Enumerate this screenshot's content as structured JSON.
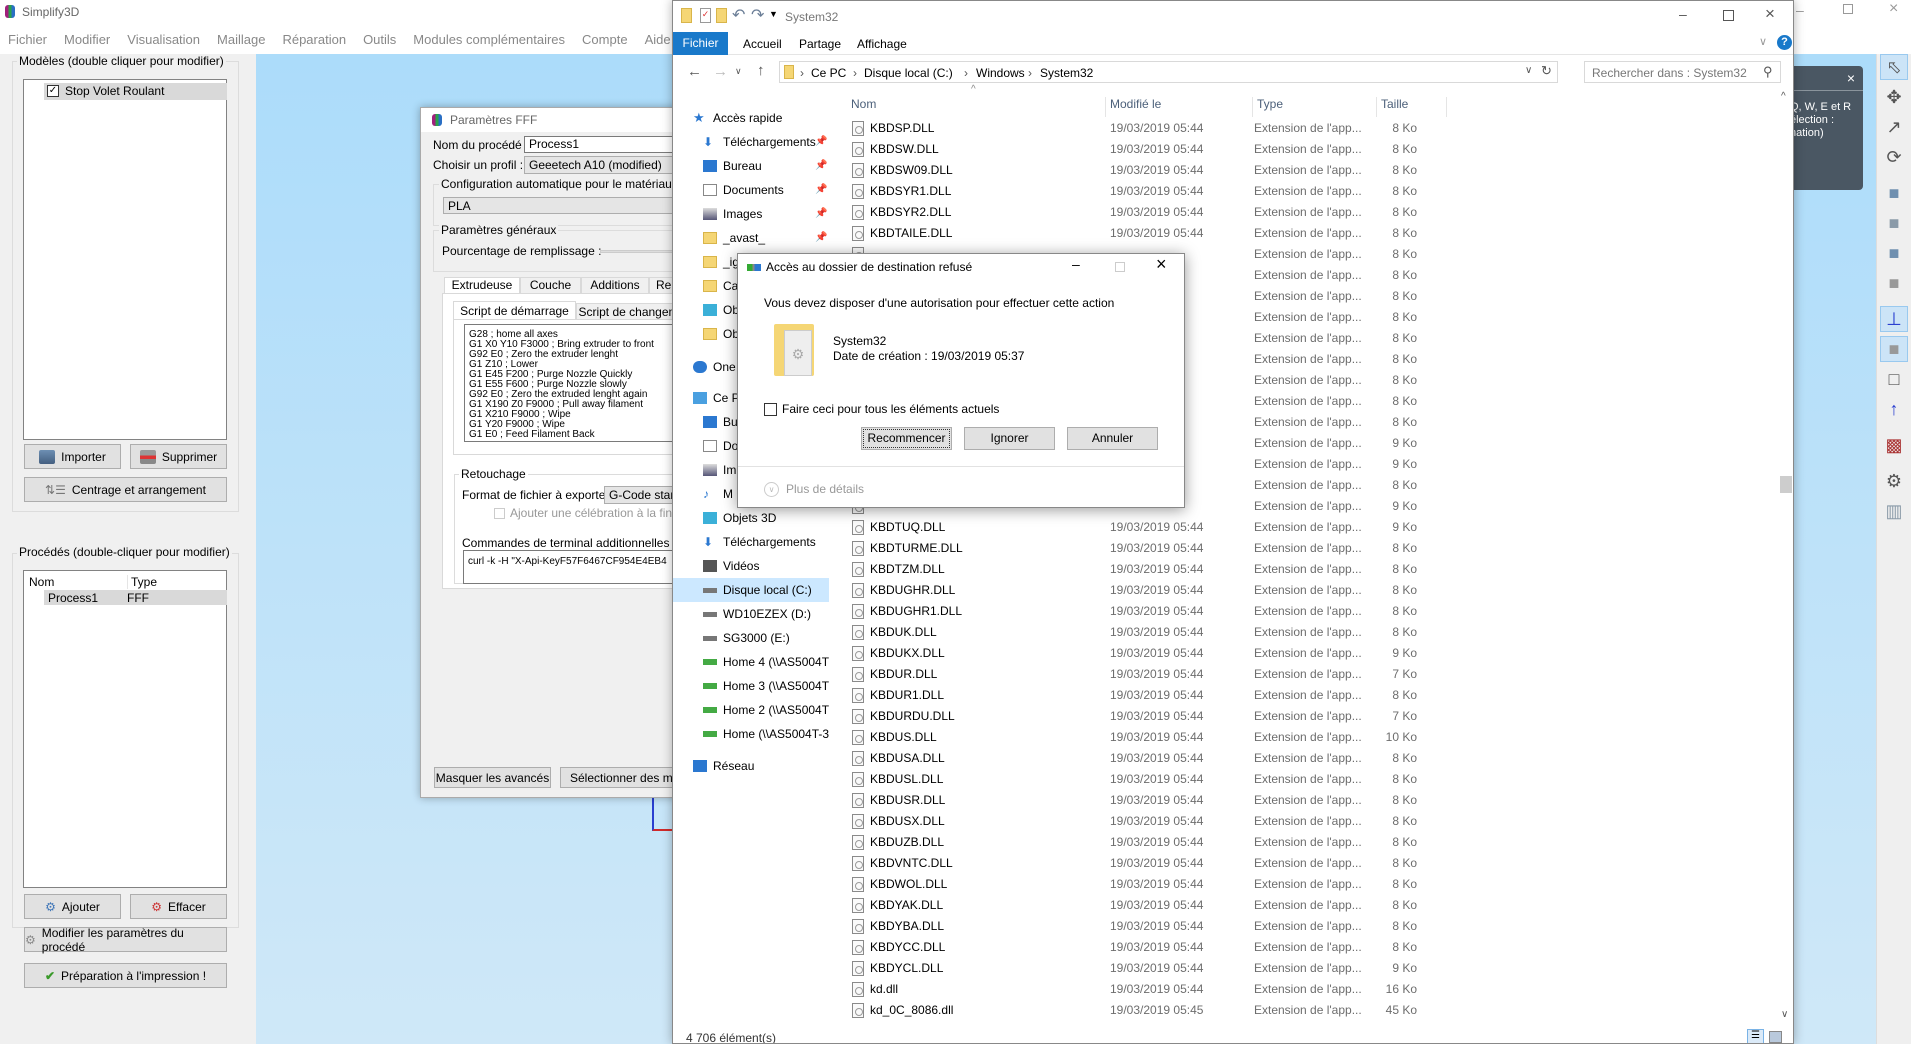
{
  "app": {
    "title": "Simplify3D",
    "menu": [
      "Fichier",
      "Modifier",
      "Visualisation",
      "Maillage",
      "Réparation",
      "Outils",
      "Modules complémentaires",
      "Compte",
      "Aide"
    ],
    "models_group": "Modèles (double cliquer pour modifier)",
    "models": [
      {
        "name": "Stop Volet Roulant",
        "checked": true
      }
    ],
    "import_btn": "Importer",
    "delete_btn": "Supprimer",
    "center_btn": "Centrage et arrangement",
    "processes_group": "Procédés (double-cliquer pour modifier)",
    "processes_headers": [
      "Nom",
      "Type"
    ],
    "processes": [
      {
        "name": "Process1",
        "type": "FFF"
      }
    ],
    "add_btn": "Ajouter",
    "erase_btn": "Effacer",
    "edit_process_btn": "Modifier les paramètres du procédé",
    "prepare_btn": "Préparation à l'impression !",
    "tooltip_lines": [
      "Q, W, E et R",
      "élection :",
      "nation)"
    ],
    "tooltip_close": "×"
  },
  "fff": {
    "title": "Paramètres FFF",
    "process_name_label": "Nom du procédé :",
    "process_name": "Process1",
    "profile_label": "Choisir un profil :",
    "profile": "Geeetech A10 (modified)",
    "material_group": "Configuration automatique pour le matériau",
    "material": "PLA",
    "general_group": "Paramètres généraux",
    "infill_label": "Pourcentage de remplissage :",
    "tabs": [
      "Extrudeuse",
      "Couche",
      "Additions",
      "Re"
    ],
    "subtabs": [
      "Script de démarrage",
      "Script de changem"
    ],
    "script_lines": [
      "G28 ; home all axes",
      "G1 X0 Y10 F3000 ; Bring extruder to front",
      "G92 E0 ; Zero the extruder lenght",
      "G1 Z10 ; Lower",
      "G1 E45 F200 ; Purge Nozzle Quickly",
      "G1 E55 F600 ; Purge Nozzle slowly",
      "G92 E0 ; Zero the extruded lenght again",
      "G1 X190 Z0 F9000 ; Pull away filament",
      "G1 X210 F9000 ; Wipe",
      "G1 Y20 F9000 ; Wipe",
      "G1 E0 ; Feed Filament Back"
    ],
    "post_group": "Retouchage",
    "export_label": "Format de fichier à exporter",
    "export_value": "G-Code stanc",
    "celebration_label": "Ajouter une célébration à la fin de",
    "terminal_label": "Commandes de terminal additionnelles pour",
    "terminal_value": "curl -k -H \"X-Api-KeyF57F6467CF954E4EB4",
    "hide_adv_btn": "Masquer les avancés",
    "select_btn": "Sélectionner des mod"
  },
  "explorer": {
    "title": "System32",
    "ribbon_tabs": [
      "Fichier",
      "Accueil",
      "Partage",
      "Affichage"
    ],
    "breadcrumb": [
      "Ce PC",
      "Disque local (C:)",
      "Windows",
      "System32"
    ],
    "search_placeholder": "Rechercher dans : System32",
    "columns": [
      "Nom",
      "Modifié le",
      "Type",
      "Taille"
    ],
    "nav": [
      {
        "label": "Accès rapide",
        "icon": "star",
        "lvl": 0,
        "pin": false
      },
      {
        "label": "Téléchargements",
        "icon": "download",
        "lvl": 1,
        "pin": true
      },
      {
        "label": "Bureau",
        "icon": "desktop",
        "lvl": 1,
        "pin": true
      },
      {
        "label": "Documents",
        "icon": "document",
        "lvl": 1,
        "pin": true
      },
      {
        "label": "Images",
        "icon": "image",
        "lvl": 1,
        "pin": true
      },
      {
        "label": "_avast_",
        "icon": "folder",
        "lvl": 1,
        "pin": true
      },
      {
        "label": "_ig",
        "icon": "folder",
        "lvl": 1,
        "pin": false
      },
      {
        "label": "Ca",
        "icon": "folder",
        "lvl": 1,
        "pin": false
      },
      {
        "label": "Ob",
        "icon": "cube",
        "lvl": 1,
        "pin": false
      },
      {
        "label": "Ob",
        "icon": "folder",
        "lvl": 1,
        "pin": false
      },
      {
        "label": "One",
        "icon": "cloud",
        "lvl": 0,
        "pin": false
      },
      {
        "label": "Ce P",
        "icon": "pc",
        "lvl": 0,
        "pin": false
      },
      {
        "label": "Bu",
        "icon": "desktop",
        "lvl": 1,
        "pin": false
      },
      {
        "label": "Do",
        "icon": "document",
        "lvl": 1,
        "pin": false
      },
      {
        "label": "Im",
        "icon": "image",
        "lvl": 1,
        "pin": false
      },
      {
        "label": "M",
        "icon": "music",
        "lvl": 1,
        "pin": false
      },
      {
        "label": "Objets 3D",
        "icon": "cube",
        "lvl": 1,
        "pin": false
      },
      {
        "label": "Téléchargements",
        "icon": "download",
        "lvl": 1,
        "pin": false
      },
      {
        "label": "Vidéos",
        "icon": "video",
        "lvl": 1,
        "pin": false
      },
      {
        "label": "Disque local (C:)",
        "icon": "drive",
        "lvl": 1,
        "pin": false,
        "selected": true
      },
      {
        "label": "WD10EZEX (D:)",
        "icon": "drive",
        "lvl": 1,
        "pin": false
      },
      {
        "label": "SG3000 (E:)",
        "icon": "drive",
        "lvl": 1,
        "pin": false
      },
      {
        "label": "Home 4 (\\\\AS5004T",
        "icon": "netdrive",
        "lvl": 1,
        "pin": false
      },
      {
        "label": "Home 3 (\\\\AS5004T",
        "icon": "netdrive",
        "lvl": 1,
        "pin": false
      },
      {
        "label": "Home 2 (\\\\AS5004T",
        "icon": "netdrive",
        "lvl": 1,
        "pin": false
      },
      {
        "label": "Home (\\\\AS5004T-3",
        "icon": "netdrive",
        "lvl": 1,
        "pin": false
      },
      {
        "label": "Réseau",
        "icon": "network",
        "lvl": 0,
        "pin": false
      }
    ],
    "files": [
      {
        "name": "KBDSP.DLL",
        "date": "19/03/2019 05:44",
        "type": "Extension de l'app...",
        "size": "8 Ko"
      },
      {
        "name": "KBDSW.DLL",
        "date": "19/03/2019 05:44",
        "type": "Extension de l'app...",
        "size": "8 Ko"
      },
      {
        "name": "KBDSW09.DLL",
        "date": "19/03/2019 05:44",
        "type": "Extension de l'app...",
        "size": "8 Ko"
      },
      {
        "name": "KBDSYR1.DLL",
        "date": "19/03/2019 05:44",
        "type": "Extension de l'app...",
        "size": "8 Ko"
      },
      {
        "name": "KBDSYR2.DLL",
        "date": "19/03/2019 05:44",
        "type": "Extension de l'app...",
        "size": "8 Ko"
      },
      {
        "name": "KBDTAILE.DLL",
        "date": "19/03/2019 05:44",
        "type": "Extension de l'app...",
        "size": "8 Ko"
      },
      {
        "name": "",
        "date": "",
        "type": "Extension de l'app...",
        "size": "8 Ko"
      },
      {
        "name": "",
        "date": "",
        "type": "Extension de l'app...",
        "size": "8 Ko"
      },
      {
        "name": "",
        "date": "",
        "type": "Extension de l'app...",
        "size": "8 Ko"
      },
      {
        "name": "",
        "date": "",
        "type": "Extension de l'app...",
        "size": "8 Ko"
      },
      {
        "name": "",
        "date": "",
        "type": "Extension de l'app...",
        "size": "8 Ko"
      },
      {
        "name": "",
        "date": "",
        "type": "Extension de l'app...",
        "size": "8 Ko"
      },
      {
        "name": "",
        "date": "",
        "type": "Extension de l'app...",
        "size": "8 Ko"
      },
      {
        "name": "",
        "date": "",
        "type": "Extension de l'app...",
        "size": "8 Ko"
      },
      {
        "name": "",
        "date": "",
        "type": "Extension de l'app...",
        "size": "8 Ko"
      },
      {
        "name": "",
        "date": "",
        "type": "Extension de l'app...",
        "size": "9 Ko"
      },
      {
        "name": "",
        "date": "",
        "type": "Extension de l'app...",
        "size": "9 Ko"
      },
      {
        "name": "",
        "date": "",
        "type": "Extension de l'app...",
        "size": "8 Ko"
      },
      {
        "name": "",
        "date": "",
        "type": "Extension de l'app...",
        "size": "9 Ko"
      },
      {
        "name": "KBDTUQ.DLL",
        "date": "19/03/2019 05:44",
        "type": "Extension de l'app...",
        "size": "9 Ko"
      },
      {
        "name": "KBDTURME.DLL",
        "date": "19/03/2019 05:44",
        "type": "Extension de l'app...",
        "size": "8 Ko"
      },
      {
        "name": "KBDTZM.DLL",
        "date": "19/03/2019 05:44",
        "type": "Extension de l'app...",
        "size": "8 Ko"
      },
      {
        "name": "KBDUGHR.DLL",
        "date": "19/03/2019 05:44",
        "type": "Extension de l'app...",
        "size": "8 Ko"
      },
      {
        "name": "KBDUGHR1.DLL",
        "date": "19/03/2019 05:44",
        "type": "Extension de l'app...",
        "size": "8 Ko"
      },
      {
        "name": "KBDUK.DLL",
        "date": "19/03/2019 05:44",
        "type": "Extension de l'app...",
        "size": "8 Ko"
      },
      {
        "name": "KBDUKX.DLL",
        "date": "19/03/2019 05:44",
        "type": "Extension de l'app...",
        "size": "9 Ko"
      },
      {
        "name": "KBDUR.DLL",
        "date": "19/03/2019 05:44",
        "type": "Extension de l'app...",
        "size": "7 Ko"
      },
      {
        "name": "KBDUR1.DLL",
        "date": "19/03/2019 05:44",
        "type": "Extension de l'app...",
        "size": "8 Ko"
      },
      {
        "name": "KBDURDU.DLL",
        "date": "19/03/2019 05:44",
        "type": "Extension de l'app...",
        "size": "7 Ko"
      },
      {
        "name": "KBDUS.DLL",
        "date": "19/03/2019 05:44",
        "type": "Extension de l'app...",
        "size": "10 Ko"
      },
      {
        "name": "KBDUSA.DLL",
        "date": "19/03/2019 05:44",
        "type": "Extension de l'app...",
        "size": "8 Ko"
      },
      {
        "name": "KBDUSL.DLL",
        "date": "19/03/2019 05:44",
        "type": "Extension de l'app...",
        "size": "8 Ko"
      },
      {
        "name": "KBDUSR.DLL",
        "date": "19/03/2019 05:44",
        "type": "Extension de l'app...",
        "size": "8 Ko"
      },
      {
        "name": "KBDUSX.DLL",
        "date": "19/03/2019 05:44",
        "type": "Extension de l'app...",
        "size": "8 Ko"
      },
      {
        "name": "KBDUZB.DLL",
        "date": "19/03/2019 05:44",
        "type": "Extension de l'app...",
        "size": "8 Ko"
      },
      {
        "name": "KBDVNTC.DLL",
        "date": "19/03/2019 05:44",
        "type": "Extension de l'app...",
        "size": "8 Ko"
      },
      {
        "name": "KBDWOL.DLL",
        "date": "19/03/2019 05:44",
        "type": "Extension de l'app...",
        "size": "8 Ko"
      },
      {
        "name": "KBDYAK.DLL",
        "date": "19/03/2019 05:44",
        "type": "Extension de l'app...",
        "size": "8 Ko"
      },
      {
        "name": "KBDYBA.DLL",
        "date": "19/03/2019 05:44",
        "type": "Extension de l'app...",
        "size": "8 Ko"
      },
      {
        "name": "KBDYCC.DLL",
        "date": "19/03/2019 05:44",
        "type": "Extension de l'app...",
        "size": "8 Ko"
      },
      {
        "name": "KBDYCL.DLL",
        "date": "19/03/2019 05:44",
        "type": "Extension de l'app...",
        "size": "9 Ko"
      },
      {
        "name": "kd.dll",
        "date": "19/03/2019 05:44",
        "type": "Extension de l'app...",
        "size": "16 Ko"
      },
      {
        "name": "kd_0C_8086.dll",
        "date": "19/03/2019 05:45",
        "type": "Extension de l'app...",
        "size": "45 Ko"
      }
    ],
    "status": "4 706 élément(s)",
    "accent": "#1979ca"
  },
  "dialog": {
    "title": "Accès au dossier de destination refusé",
    "message": "Vous devez disposer d'une autorisation pour effectuer cette action",
    "item_name": "System32",
    "item_date": "Date de création : 19/03/2019 05:37",
    "checkbox_label": "Faire ceci pour tous les éléments actuels",
    "retry_btn": "Recommencer",
    "skip_btn": "Ignorer",
    "cancel_btn": "Annuler",
    "details": "Plus de détails"
  }
}
